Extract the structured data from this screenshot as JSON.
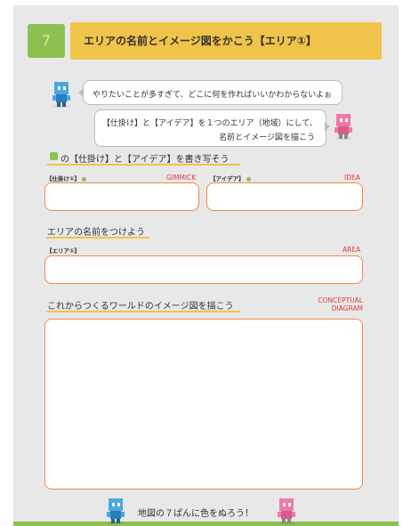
{
  "header": {
    "number": "7",
    "title": "エリアの名前とイメージ図をかこう【エリア①】"
  },
  "dialog": {
    "bubble1": "やりたいことが多すぎて、どこに何を作ればいいかわからないよぉ",
    "bubble2_line1": "【仕掛け】と【アイデア】を１つのエリア（地域）にして、",
    "bubble2_line2": "名前とイメージ図を描こう"
  },
  "section_copy": {
    "heading": "の【仕掛け】と【アイデア】を書き写そう",
    "gimmick_label": "【仕掛け①】",
    "gimmick_tag": "GIMMICK",
    "idea_label": "【アイデア】",
    "idea_tag": "IDEA"
  },
  "section_name": {
    "heading": "エリアの名前をつけよう",
    "area_label": "【エリア①】",
    "area_tag": "AREA"
  },
  "section_image": {
    "heading": "これからつくるワールドのイメージ図を描こう",
    "tag_line1": "CONCEPTUAL",
    "tag_line2": "DIAGRAM"
  },
  "footer": {
    "text": "地図の７ぱんに色をぬろう！"
  },
  "colors": {
    "accent_green": "#8cc152",
    "accent_yellow": "#f0c34a",
    "field_border": "#f08a4b",
    "tag_red": "#e23b3b",
    "char_blue": "#4aa8e0",
    "char_pink": "#f07aa8"
  }
}
